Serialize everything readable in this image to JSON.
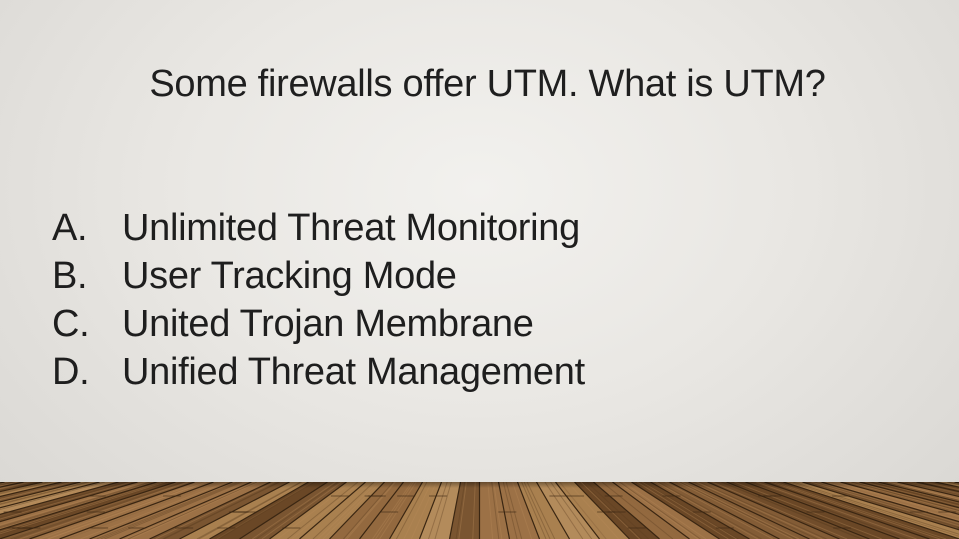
{
  "slide": {
    "question": "Some firewalls offer UTM. What is UTM?",
    "options": [
      {
        "letter": "A.",
        "text": "Unlimited Threat Monitoring"
      },
      {
        "letter": "B.",
        "text": "User Tracking Mode"
      },
      {
        "letter": "C.",
        "text": "United Trojan Membrane"
      },
      {
        "letter": "D.",
        "text": "Unified Threat Management"
      }
    ]
  },
  "colors": {
    "background": "#ebe9e5",
    "text": "#1f1f1f",
    "floor_dark": "#5a3b20",
    "floor_light": "#b78a58"
  }
}
